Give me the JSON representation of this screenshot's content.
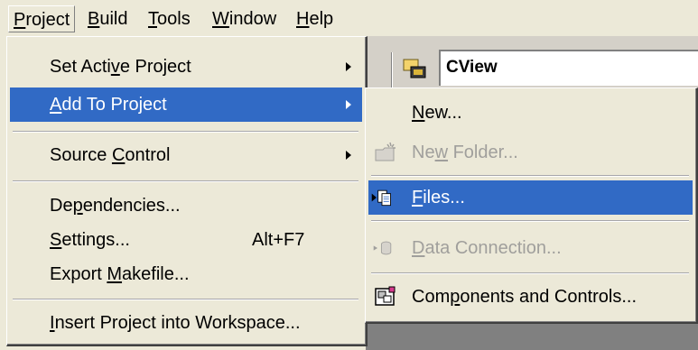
{
  "menubar": {
    "items": [
      {
        "label": "Project",
        "underline": "P"
      },
      {
        "label": "Build",
        "underline": "B"
      },
      {
        "label": "Tools",
        "underline": "T"
      },
      {
        "label": "Window",
        "underline": "W"
      },
      {
        "label": "Help",
        "underline": "H"
      }
    ]
  },
  "toolbar": {
    "config_combo_value": "CView"
  },
  "project_menu": {
    "items": [
      {
        "pre": "Set Acti",
        "u": "v",
        "post": "e Project",
        "accel": "",
        "submenu": true
      },
      {
        "pre": "",
        "u": "A",
        "post": "dd To Project",
        "accel": "",
        "submenu": true
      },
      {
        "pre": "Source ",
        "u": "C",
        "post": "ontrol",
        "accel": "",
        "submenu": true
      },
      {
        "pre": "De",
        "u": "p",
        "post": "endencies...",
        "accel": ""
      },
      {
        "pre": "",
        "u": "S",
        "post": "ettings...",
        "accel": "Alt+F7"
      },
      {
        "pre": "Export ",
        "u": "M",
        "post": "akefile...",
        "accel": ""
      },
      {
        "pre": "",
        "u": "I",
        "post": "nsert Project into Workspace...",
        "accel": ""
      }
    ]
  },
  "add_to_project_submenu": {
    "items": [
      {
        "pre": "",
        "u": "N",
        "post": "ew...",
        "icon": "",
        "enabled": true
      },
      {
        "pre": "Ne",
        "u": "w",
        "post": " Folder...",
        "icon": "new-folder-icon",
        "enabled": false
      },
      {
        "pre": "",
        "u": "F",
        "post": "iles...",
        "icon": "add-files-icon",
        "enabled": true
      },
      {
        "pre": "",
        "u": "D",
        "post": "ata Connection...",
        "icon": "data-connection-icon",
        "enabled": false
      },
      {
        "pre": "Com",
        "u": "p",
        "post": "onents and Controls...",
        "icon": "components-icon",
        "enabled": true
      }
    ]
  },
  "colors": {
    "menu_bg": "#ece9d8",
    "highlight": "#316ac5",
    "disabled_text": "#a09f9c",
    "workspace_dark": "#808080"
  }
}
